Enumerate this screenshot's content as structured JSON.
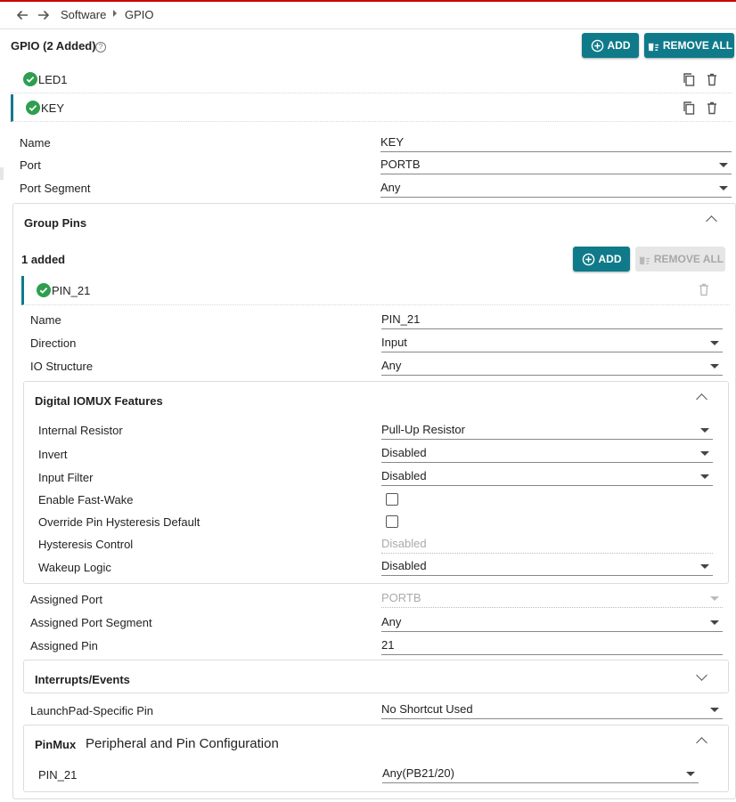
{
  "breadcrumb": {
    "items": [
      "Software",
      "GPIO"
    ]
  },
  "gpio": {
    "title": "GPIO (2 Added)",
    "add_label": "ADD",
    "remove_all_label": "REMOVE ALL",
    "items": [
      {
        "label": "LED1"
      },
      {
        "label": "KEY"
      }
    ]
  },
  "key_fields": {
    "name": {
      "label": "Name",
      "value": "KEY"
    },
    "port": {
      "label": "Port",
      "value": "PORTB"
    },
    "port_segment": {
      "label": "Port Segment",
      "value": "Any"
    }
  },
  "group_pins": {
    "title": "Group Pins",
    "count_text": "1 added",
    "add_label": "ADD",
    "remove_all_label": "REMOVE ALL",
    "pin": {
      "label": "PIN_21"
    },
    "fields": {
      "name": {
        "label": "Name",
        "value": "PIN_21"
      },
      "direction": {
        "label": "Direction",
        "value": "Input"
      },
      "io_structure": {
        "label": "IO Structure",
        "value": "Any"
      }
    }
  },
  "iomux": {
    "title": "Digital IOMUX Features",
    "internal_resistor": {
      "label": "Internal Resistor",
      "value": "Pull-Up Resistor"
    },
    "invert": {
      "label": "Invert",
      "value": "Disabled"
    },
    "input_filter": {
      "label": "Input Filter",
      "value": "Disabled"
    },
    "fast_wake": {
      "label": "Enable Fast-Wake",
      "checked": false
    },
    "override_hysteresis": {
      "label": "Override Pin Hysteresis Default",
      "checked": false
    },
    "hysteresis_control": {
      "label": "Hysteresis Control",
      "value": "Disabled"
    },
    "wakeup_logic": {
      "label": "Wakeup Logic",
      "value": "Disabled"
    }
  },
  "assigned": {
    "port": {
      "label": "Assigned Port",
      "value": "PORTB"
    },
    "port_segment": {
      "label": "Assigned Port Segment",
      "value": "Any"
    },
    "pin": {
      "label": "Assigned Pin",
      "value": "21"
    }
  },
  "interrupts": {
    "title": "Interrupts/Events"
  },
  "launchpad": {
    "label": "LaunchPad-Specific Pin",
    "value": "No Shortcut Used"
  },
  "pinmux": {
    "title": "PinMux",
    "subtitle": "Peripheral and Pin Configuration",
    "pin": {
      "label": "PIN_21",
      "value": "Any(PB21/20)"
    }
  },
  "colors": {
    "accent": "#0f7a8a",
    "success": "#2e9e4f",
    "top_bar": "#cc0000"
  }
}
